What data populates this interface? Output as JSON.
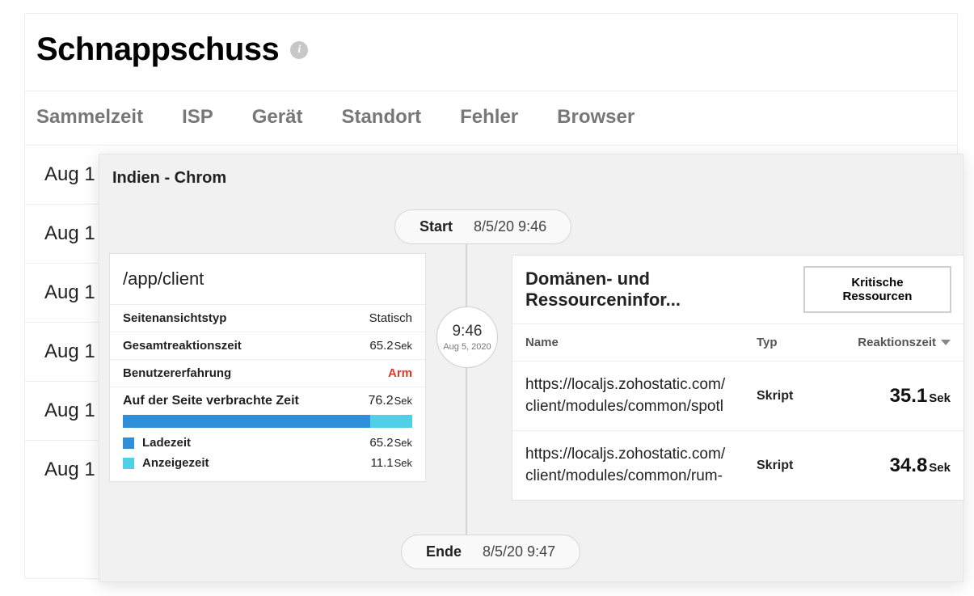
{
  "header": {
    "title": "Schnappschuss"
  },
  "tabs": [
    "Sammelzeit",
    "ISP",
    "Gerät",
    "Standort",
    "Fehler",
    "Browser"
  ],
  "rows": [
    "Aug 1",
    "Aug 1",
    "Aug 1",
    "Aug 1",
    "Aug 1",
    "Aug 1"
  ],
  "overlay": {
    "title": "Indien - Chrom",
    "start": {
      "label": "Start",
      "value": "8/5/20 9:46"
    },
    "end": {
      "label": "Ende",
      "value": "8/5/20 9:47"
    },
    "circle": {
      "time": "9:46",
      "date": "Aug 5, 2020"
    },
    "detail": {
      "title": "/app/client",
      "metrics": {
        "pageviewtype": {
          "label": "Seitenansichtstyp",
          "value": "Statisch"
        },
        "totalresponse": {
          "label": "Gesamtreaktionszeit",
          "value": "65.2",
          "unit": "Sek"
        },
        "ux": {
          "label": "Benutzererfahrung",
          "value": "Arm"
        },
        "timeonpage": {
          "label": "Auf der Seite verbrachte Zeit",
          "value": "76.2",
          "unit": "Sek"
        },
        "loadtime": {
          "label": "Ladezeit",
          "value": "65.2",
          "unit": "Sek"
        },
        "viewtime": {
          "label": "Anzeigezeit",
          "value": "11.1",
          "unit": "Sek"
        }
      }
    },
    "resources": {
      "title": "Domänen- und Ressourceninfor...",
      "crit_button": "Kritische Ressourcen",
      "cols": {
        "name": "Name",
        "type": "Typ",
        "rt": "Reaktionszeit"
      },
      "rows": [
        {
          "url_l1": "https://localjs.zohostatic.com/",
          "url_l2": "client/modules/common/spotl",
          "type": "Skript",
          "rt": "35.1",
          "unit": "Sek"
        },
        {
          "url_l1": "https://localjs.zohostatic.com/",
          "url_l2": "client/modules/common/rum-",
          "type": "Skript",
          "rt": "34.8",
          "unit": "Sek"
        }
      ]
    }
  }
}
